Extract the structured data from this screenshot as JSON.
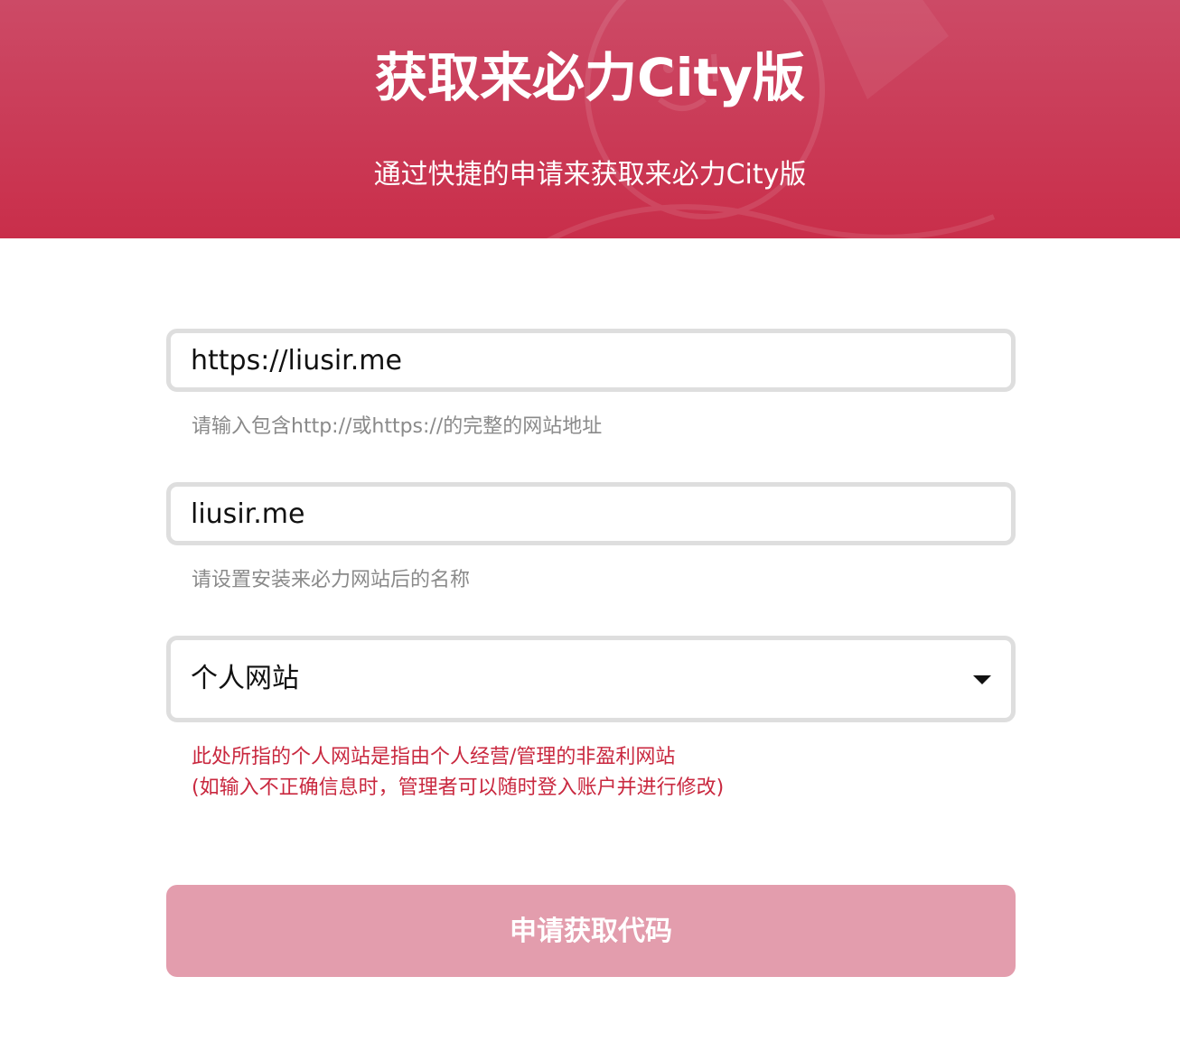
{
  "header": {
    "title": "获取来必力City版",
    "subtitle": "通过快捷的申请来获取来必力City版"
  },
  "form": {
    "url": {
      "value": "https://liusir.me",
      "hint": "请输入包含http://或https://的完整的网站地址"
    },
    "name": {
      "value": "liusir.me",
      "hint": "请设置安装来必力网站后的名称"
    },
    "site_type": {
      "selected": "个人网站",
      "hint_line1": "此处所指的个人网站是指由个人经营/管理的非盈利网站",
      "hint_line2": "(如输入不正确信息时，管理者可以随时登入账户并进行修改)"
    },
    "submit_label": "申请获取代码"
  },
  "colors": {
    "header_top": "#cc4a66",
    "header_bottom": "#c92e4a",
    "hint_red": "#c9283f",
    "button": "#e39dad"
  }
}
